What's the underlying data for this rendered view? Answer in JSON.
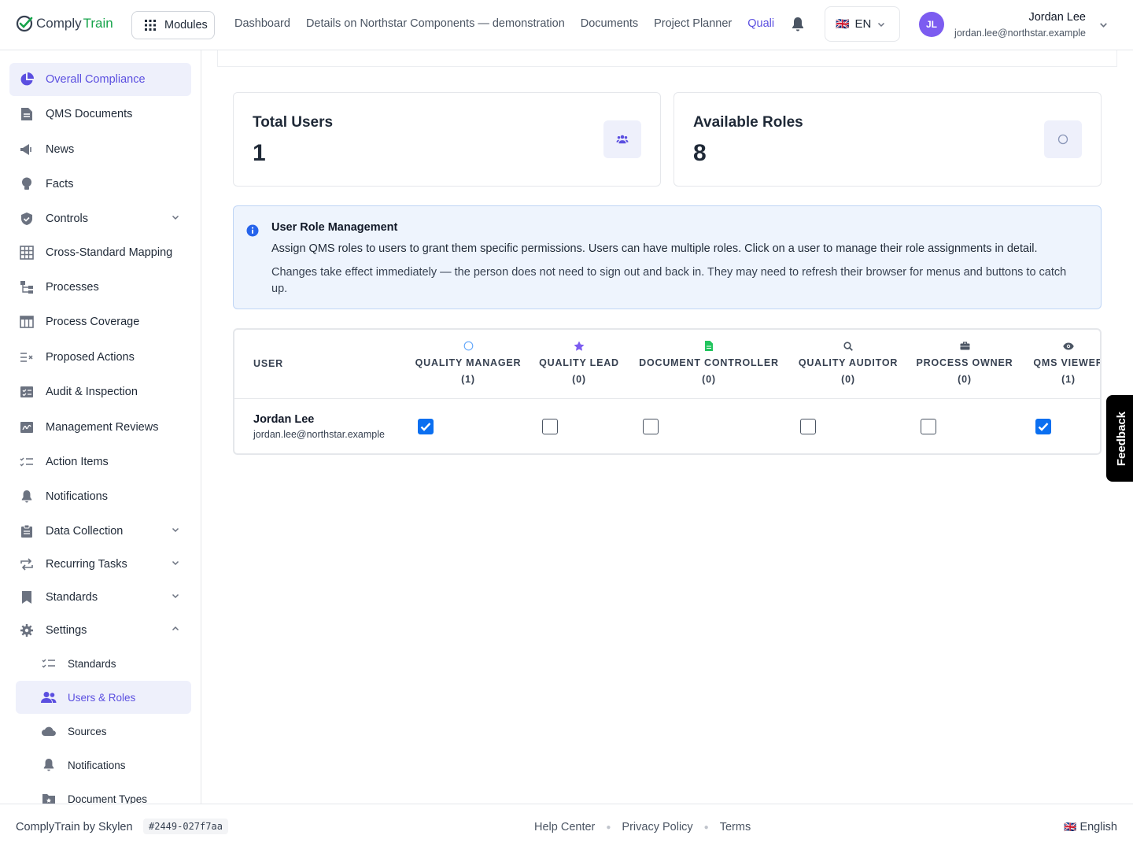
{
  "app": {
    "logo_part1": "Comply",
    "logo_part2": "Train"
  },
  "header": {
    "modules_label": "Modules",
    "nav": [
      "Dashboard",
      "Details on Northstar Components — demonstration",
      "Documents",
      "Project Planner",
      "Quali"
    ],
    "active_nav": "Quali",
    "language_code": "EN",
    "language_flag": "🇬🇧",
    "user": {
      "initials": "JL",
      "name": "Jordan Lee",
      "email": "jordan.lee@northstar.example"
    }
  },
  "sidebar": {
    "items": [
      {
        "label": "Overall Compliance",
        "icon": "pie-chart-icon",
        "active": true
      },
      {
        "label": "QMS Documents",
        "icon": "document-icon"
      },
      {
        "label": "News",
        "icon": "megaphone-icon"
      },
      {
        "label": "Facts",
        "icon": "lightbulb-icon"
      },
      {
        "label": "Controls",
        "icon": "shield-icon",
        "expandable": true
      },
      {
        "label": "Cross-Standard Mapping",
        "icon": "grid-icon"
      },
      {
        "label": "Processes",
        "icon": "process-icon"
      },
      {
        "label": "Process Coverage",
        "icon": "table-icon"
      },
      {
        "label": "Proposed Actions",
        "icon": "list-x-icon"
      },
      {
        "label": "Audit & Inspection",
        "icon": "checklist-icon"
      },
      {
        "label": "Management Reviews",
        "icon": "signature-icon"
      },
      {
        "label": "Action Items",
        "icon": "checklist-lines-icon"
      },
      {
        "label": "Notifications",
        "icon": "bell-icon"
      },
      {
        "label": "Data Collection",
        "icon": "clipboard-icon",
        "expandable": true
      },
      {
        "label": "Recurring Tasks",
        "icon": "repeat-icon",
        "expandable": true
      },
      {
        "label": "Standards",
        "icon": "bookmark-icon",
        "expandable": true
      },
      {
        "label": "Settings",
        "icon": "gear-icon",
        "expanded": true
      }
    ],
    "settings_sub": [
      {
        "label": "Standards",
        "icon": "checklist-lines-icon"
      },
      {
        "label": "Users & Roles",
        "icon": "users-icon",
        "active": true
      },
      {
        "label": "Sources",
        "icon": "cloud-icon"
      },
      {
        "label": "Notifications",
        "icon": "bell-icon"
      },
      {
        "label": "Document Types",
        "icon": "folder-star-icon"
      }
    ]
  },
  "stats": {
    "total_users": {
      "title": "Total Users",
      "value": "1",
      "icon": "users-icon"
    },
    "available_roles": {
      "title": "Available Roles",
      "value": "8",
      "icon": "circle-icon"
    }
  },
  "info": {
    "title": "User Role Management",
    "line1": "Assign QMS roles to users to grant them specific permissions. Users can have multiple roles. Click on a user to manage their role assignments in detail.",
    "line2": "Changes take effect immediately — the person does not need to sign out and back in. They may need to refresh their browser for menus and buttons to catch up."
  },
  "table": {
    "user_header": "USER",
    "roles": [
      {
        "label": "QUALITY MANAGER",
        "count": "(1)",
        "icon": "circle-outline-icon",
        "color": "#60a5fa"
      },
      {
        "label": "QUALITY LEAD",
        "count": "(0)",
        "icon": "star-icon",
        "color": "#7c5cf0"
      },
      {
        "label": "DOCUMENT CONTROLLER",
        "count": "(0)",
        "icon": "file-icon",
        "color": "#22c55e"
      },
      {
        "label": "QUALITY AUDITOR",
        "count": "(0)",
        "icon": "search-icon",
        "color": "#4b5563"
      },
      {
        "label": "PROCESS OWNER",
        "count": "(0)",
        "icon": "briefcase-icon",
        "color": "#4b5563"
      },
      {
        "label": "QMS VIEWER",
        "count": "(1)",
        "icon": "eye-icon",
        "color": "#4b5563"
      }
    ],
    "rows": [
      {
        "name": "Jordan Lee",
        "email": "jordan.lee@northstar.example",
        "assigned": [
          true,
          false,
          false,
          false,
          false,
          true
        ]
      }
    ]
  },
  "feedback_label": "Feedback",
  "footer": {
    "brand": "ComplyTrain by Skylen",
    "build": "#2449-027f7aa",
    "links": [
      "Help Center",
      "Privacy Policy",
      "Terms"
    ],
    "language": "English",
    "language_flag": "🇬🇧"
  },
  "colors": {
    "accent": "#5b4fe0",
    "checkbox": "#0b6ff0",
    "info_bg": "#eef4fd",
    "logo_green": "#16a34a"
  }
}
